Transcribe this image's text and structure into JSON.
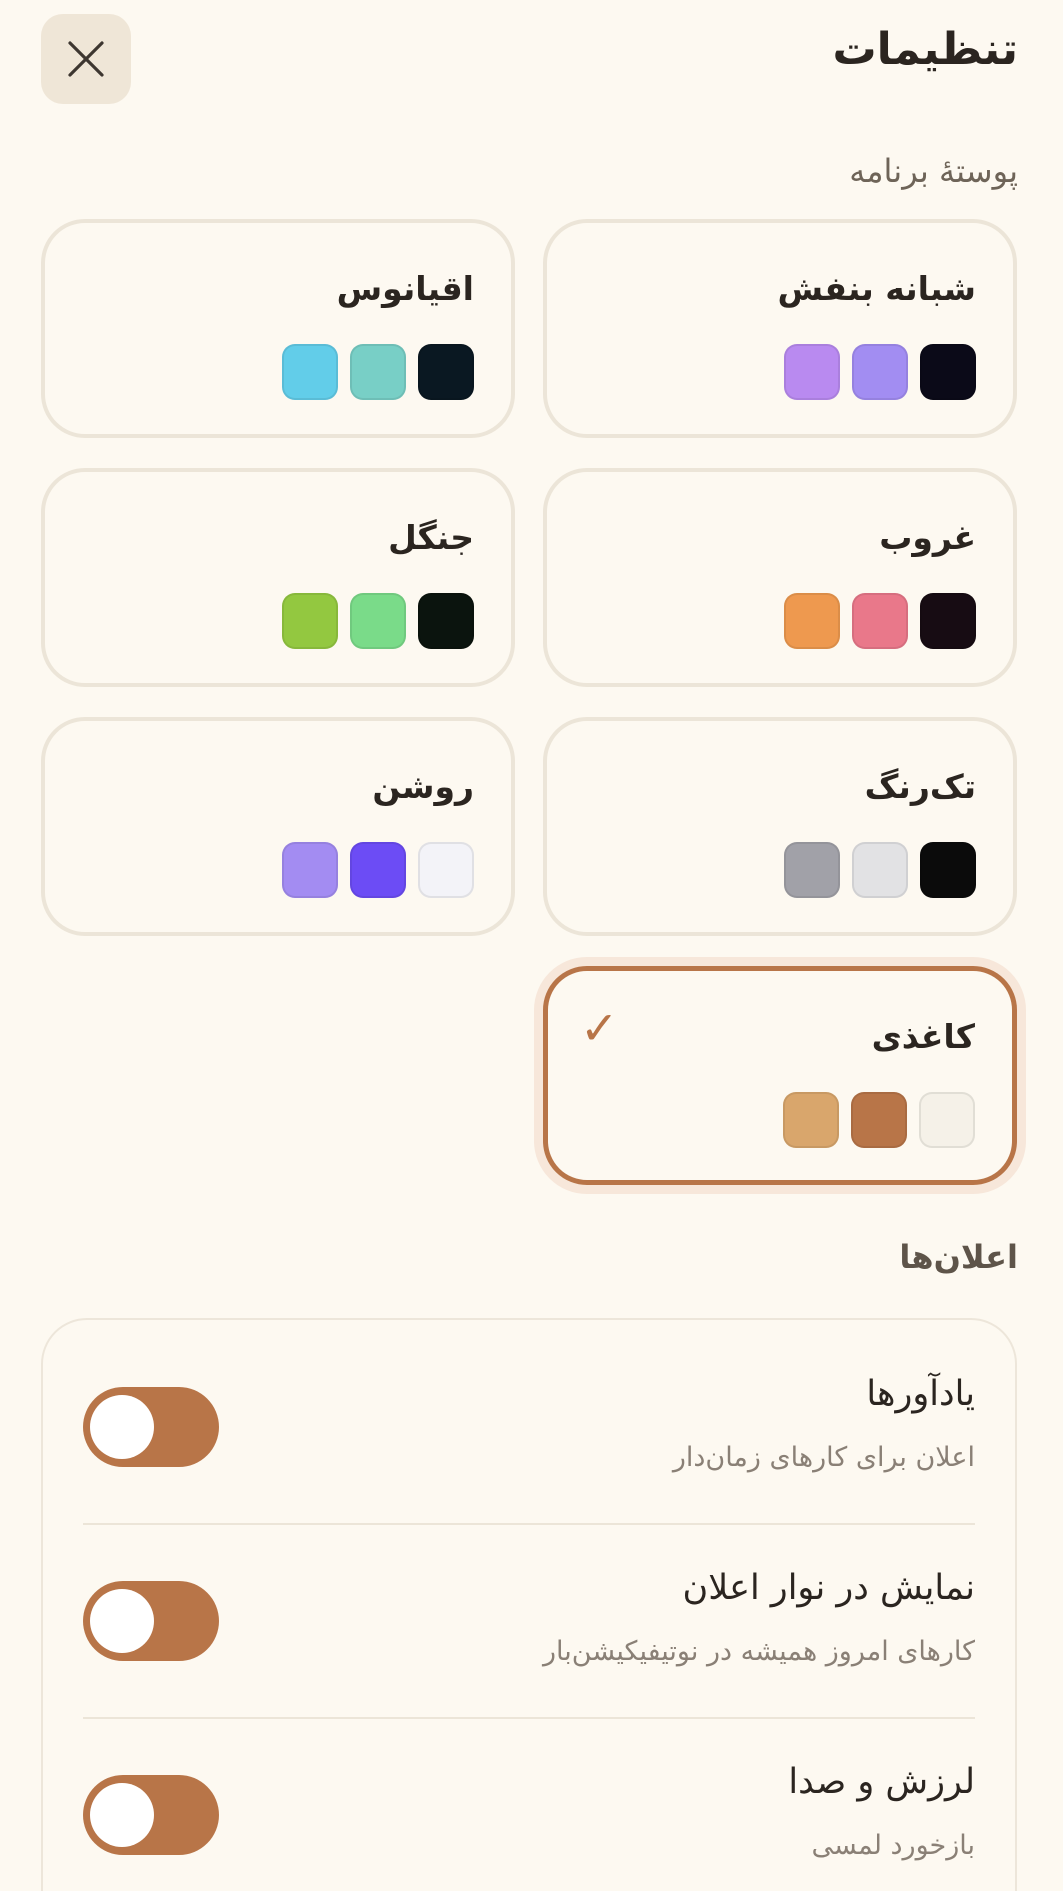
{
  "header": {
    "title": "تنظیمات",
    "close_icon": "close-icon"
  },
  "skin_section": {
    "label": "پوستهٔ برنامه",
    "themes": [
      {
        "name": "شبانه بنفش",
        "colors": [
          "#b98af0",
          "#a28df2",
          "#0b0a18"
        ],
        "selected": false
      },
      {
        "name": "اقیانوس",
        "colors": [
          "#62cde9",
          "#78cfc6",
          "#0a1822"
        ],
        "selected": false
      },
      {
        "name": "غروب",
        "colors": [
          "#ee994f",
          "#e9788a",
          "#170c13"
        ],
        "selected": false
      },
      {
        "name": "جنگل",
        "colors": [
          "#93c840",
          "#7adb89",
          "#0b140e"
        ],
        "selected": false
      },
      {
        "name": "تک‌رنگ",
        "colors": [
          "#a1a1a8",
          "#e2e2e4",
          "#0b0b0b"
        ],
        "selected": false
      },
      {
        "name": "روشن",
        "colors": [
          "#a38cf2",
          "#6c4cf5",
          "#f3f3f8"
        ],
        "selected": false
      },
      {
        "name": "کاغذی",
        "colors": [
          "#d9a66c",
          "#b87548",
          "#f5f1e8"
        ],
        "selected": true
      }
    ],
    "check_mark": "✓"
  },
  "notifications_section": {
    "label": "اعلان‌ها",
    "items": [
      {
        "title": "یادآورها",
        "subtitle": "اعلان برای کارهای زمان‌دار",
        "enabled": true
      },
      {
        "title": "نمایش در نوار اعلان",
        "subtitle": "کارهای امروز همیشه در نوتیفیکیشن‌بار",
        "enabled": true
      },
      {
        "title": "لرزش و صدا",
        "subtitle": "بازخورد لمسی",
        "enabled": true
      }
    ]
  },
  "colors": {
    "accent": "#b87548",
    "background": "#fdf9f1",
    "card_border": "#ece5d8"
  }
}
